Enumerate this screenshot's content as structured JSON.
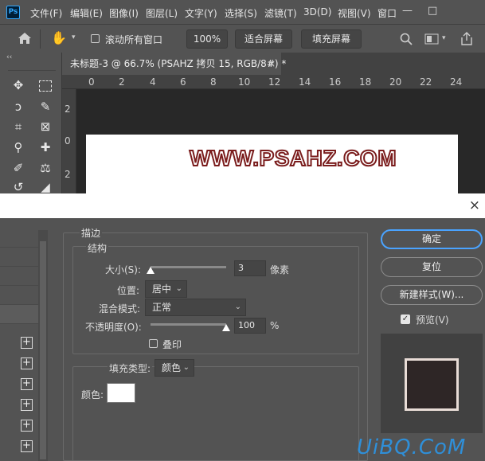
{
  "app": {
    "logo": "Ps",
    "menus": [
      "文件(F)",
      "编辑(E)",
      "图像(I)",
      "图层(L)",
      "文字(Y)",
      "选择(S)",
      "滤镜(T)",
      "3D(D)",
      "视图(V)",
      "窗口"
    ],
    "window_controls": [
      "—",
      "□"
    ]
  },
  "options": {
    "scroll_all": "滚动所有窗口",
    "zoom": "100%",
    "fit_screen": "适合屏幕",
    "fill_screen": "填充屏幕"
  },
  "tabs": {
    "collapse": "‹‹",
    "doc_title": "未标题-3 @ 66.7% (PSAHZ 拷贝 15, RGB/8#) *",
    "close": "×"
  },
  "ruler": {
    "top": [
      "0",
      "2",
      "4",
      "6",
      "8",
      "10",
      "12",
      "14",
      "16",
      "18",
      "20",
      "22",
      "24"
    ],
    "left": [
      "2",
      "0",
      "2"
    ]
  },
  "canvas": {
    "text": "WWW.PSAHZ.COM"
  },
  "dialog": {
    "close": "×",
    "section": "描边",
    "structure": "结构",
    "size_label": "大小(S):",
    "size_value": "3",
    "size_unit": "像素",
    "position_label": "位置:",
    "position_value": "居中",
    "blend_label": "混合模式:",
    "blend_value": "正常",
    "opacity_label": "不透明度(O):",
    "opacity_value": "100",
    "opacity_unit": "%",
    "overprint": "叠印",
    "fill_type_label": "填充类型:",
    "fill_type_value": "颜色",
    "color_label": "颜色:",
    "btn_ok": "确定",
    "btn_reset": "复位",
    "btn_new_style": "新建样式(W)...",
    "preview": "预览(V)",
    "plus": "+"
  },
  "watermark": "UiBQ.CoM",
  "colors": {
    "accent": "#31a8ff",
    "stroke": "#7a1c1c",
    "watermark": "#2f8fd8"
  }
}
